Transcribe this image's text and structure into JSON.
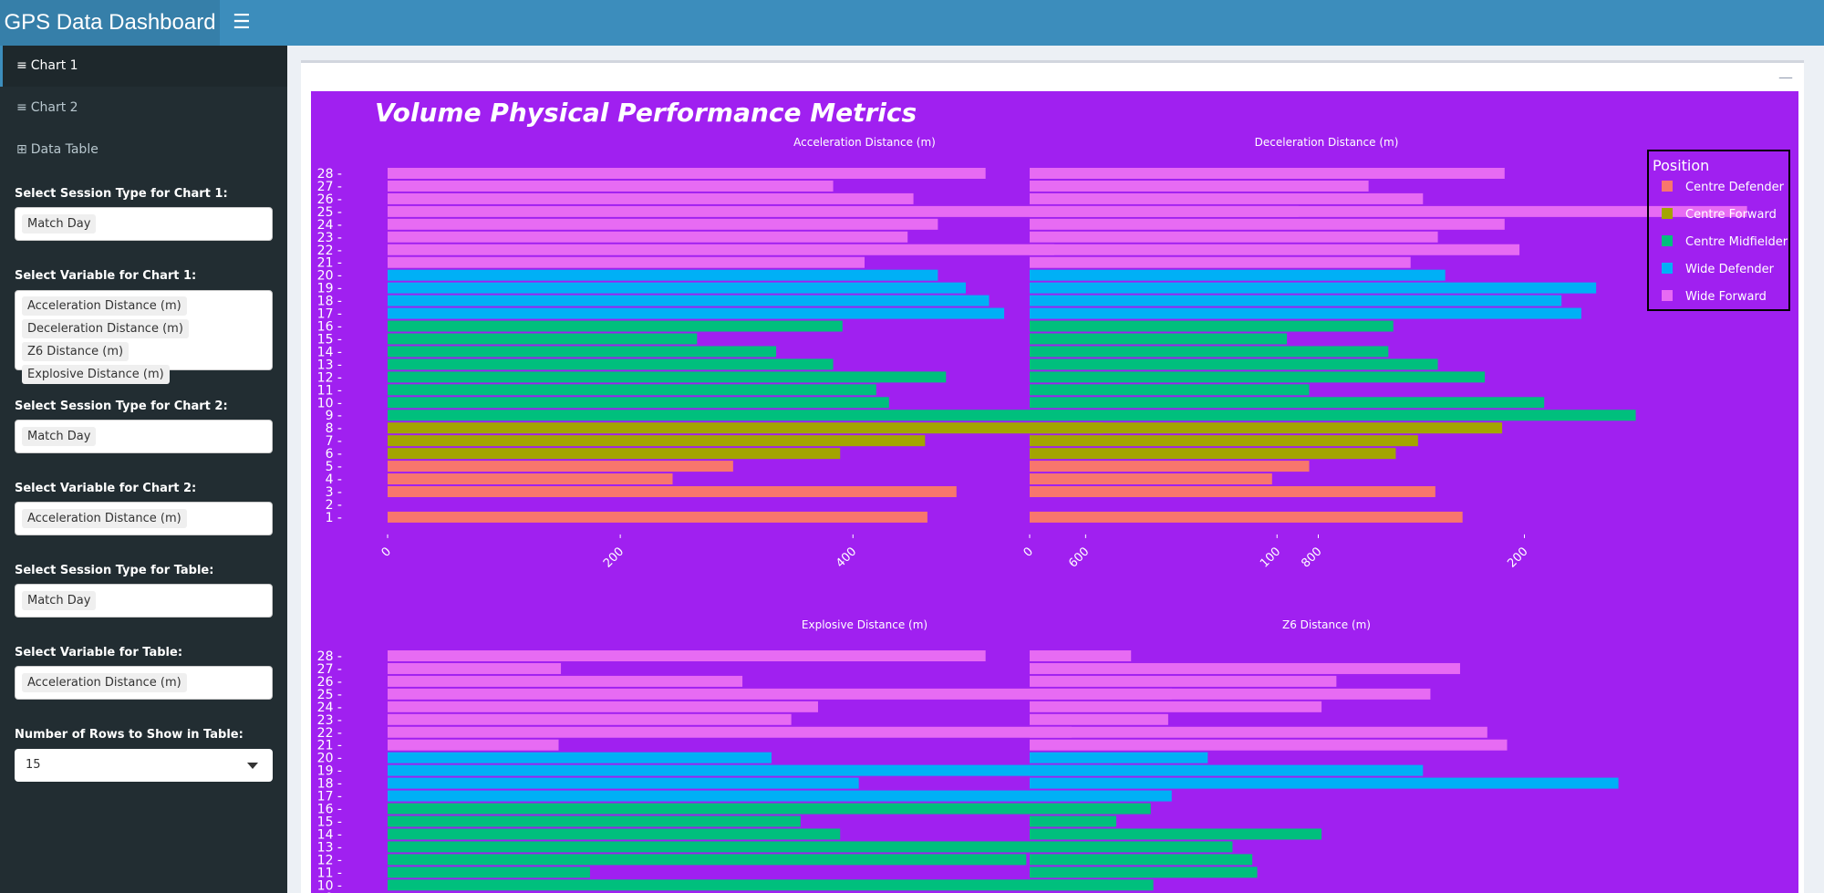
{
  "header": {
    "title": "GPS Data Dashboard",
    "toggle_icon": "hamburger-icon"
  },
  "sidebar": {
    "menu": [
      {
        "label": "Chart 1",
        "icon": "bar-chart-icon",
        "active": true
      },
      {
        "label": "Chart 2",
        "icon": "bar-chart-icon"
      },
      {
        "label": "Data Table",
        "icon": "table-icon"
      }
    ],
    "controls": {
      "session_chart1": {
        "label": "Select Session Type for Chart 1:",
        "values": [
          "Match Day"
        ]
      },
      "variable_chart1": {
        "label": "Select Variable for Chart 1:",
        "values": [
          "Acceleration Distance (m)",
          "Deceleration Distance (m)",
          "Z6 Distance (m)",
          "Explosive Distance (m)"
        ]
      },
      "session_chart2": {
        "label": "Select Session Type for Chart 2:",
        "values": [
          "Match Day"
        ]
      },
      "variable_chart2": {
        "label": "Select Variable for Chart 2:",
        "values": [
          "Acceleration Distance (m)"
        ]
      },
      "session_table": {
        "label": "Select Session Type for Table:",
        "values": [
          "Match Day"
        ]
      },
      "variable_table": {
        "label": "Select Variable for Table:",
        "values": [
          "Acceleration Distance (m)"
        ]
      },
      "rows_table": {
        "label": "Number of Rows to Show in Table:",
        "value": "15"
      }
    }
  },
  "box": {
    "collapse_icon": "minus-icon"
  },
  "chart_data": {
    "type": "bar",
    "orientation": "horizontal",
    "title": "Volume Physical Performance Metrics",
    "background": "#a020f0",
    "legend": {
      "title": "Position",
      "placement": "top-right",
      "entries": [
        {
          "name": "Centre Defender",
          "color": "#f8766d"
        },
        {
          "name": "Centre Forward",
          "color": "#a3a500"
        },
        {
          "name": "Centre Midfielder",
          "color": "#00bf7d"
        },
        {
          "name": "Wide Defender",
          "color": "#00b0f6"
        },
        {
          "name": "Wide Forward",
          "color": "#e76bf3"
        }
      ]
    },
    "categories": [
      "1",
      "2",
      "3",
      "4",
      "5",
      "6",
      "7",
      "8",
      "9",
      "10",
      "11",
      "12",
      "13",
      "14",
      "15",
      "16",
      "17",
      "18",
      "19",
      "20",
      "21",
      "22",
      "23",
      "24",
      "25",
      "26",
      "27",
      "28"
    ],
    "positions": [
      "Centre Defender",
      null,
      "Centre Defender",
      "Centre Defender",
      "Centre Defender",
      "Centre Forward",
      "Centre Forward",
      "Centre Forward",
      "Centre Midfielder",
      "Centre Midfielder",
      "Centre Midfielder",
      "Centre Midfielder",
      "Centre Midfielder",
      "Centre Midfielder",
      "Centre Midfielder",
      "Centre Midfielder",
      "Wide Defender",
      "Wide Defender",
      "Wide Defender",
      "Wide Defender",
      "Wide Forward",
      "Wide Forward",
      "Wide Forward",
      "Wide Forward",
      "Wide Forward",
      "Wide Forward",
      "Wide Forward",
      "Wide Forward"
    ],
    "panels": [
      {
        "title": "Acceleration Distance (m)",
        "xlim": [
          0,
          820
        ],
        "xticks": [
          "0",
          "200",
          "400",
          "600",
          "800"
        ],
        "values": [
          464,
          null,
          489,
          245,
          297,
          389,
          462,
          615,
          586,
          431,
          420,
          480,
          383,
          334,
          266,
          391,
          530,
          517,
          497,
          473,
          410,
          573,
          447,
          473,
          783,
          452,
          383,
          514
        ]
      },
      {
        "title": "Deceleration Distance (m)",
        "xlim": [
          0,
          240
        ],
        "xticks": [
          "0",
          "100",
          "200"
        ],
        "values": [
          175,
          null,
          164,
          98,
          113,
          148,
          157,
          191,
          245,
          208,
          113,
          184,
          165,
          145,
          104,
          147,
          223,
          215,
          229,
          168,
          154,
          198,
          165,
          192,
          290,
          159,
          137,
          192
        ]
      },
      {
        "title": "Explosive Distance (m)",
        "xlim": [
          0,
          820
        ],
        "xticks": [],
        "values": [
          null,
          null,
          null,
          null,
          null,
          null,
          null,
          null,
          null,
          619,
          174,
          549,
          553,
          389,
          355,
          656,
          674,
          405,
          622,
          330,
          147,
          588,
          347,
          370,
          674,
          305,
          149,
          514
        ]
      },
      {
        "title": "Z6 Distance (m)",
        "xlim": [
          0,
          240
        ],
        "xticks": [],
        "values": [
          null,
          null,
          null,
          null,
          null,
          null,
          null,
          null,
          null,
          50,
          92,
          90,
          82,
          118,
          35,
          39,
          49,
          238,
          159,
          72,
          193,
          185,
          56,
          118,
          162,
          124,
          174,
          41
        ]
      }
    ]
  }
}
